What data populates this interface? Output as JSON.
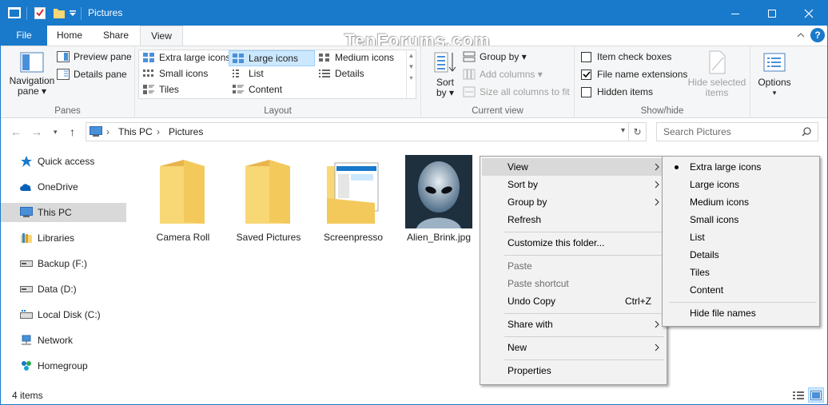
{
  "window": {
    "title": "Pictures"
  },
  "tabs": {
    "file": "File",
    "home": "Home",
    "share": "Share",
    "view": "View"
  },
  "watermark": "TenForums.com",
  "ribbon": {
    "panes": {
      "navigation_pane": "Navigation",
      "navigation_pane_sub": "pane",
      "preview_pane": "Preview pane",
      "details_pane": "Details pane",
      "label": "Panes"
    },
    "layout": {
      "label": "Layout",
      "options": [
        "Extra large icons",
        "Large icons",
        "Medium icons",
        "Small icons",
        "List",
        "Details",
        "Tiles",
        "Content"
      ],
      "selected": "Large icons"
    },
    "current_view": {
      "sort_by": "Sort",
      "sort_by_sub": "by",
      "group_by": "Group by",
      "add_columns": "Add columns",
      "size_columns": "Size all columns to fit",
      "label": "Current view"
    },
    "show_hide": {
      "item_check_boxes": "Item check boxes",
      "file_name_extensions": "File name extensions",
      "hidden_items": "Hidden items",
      "hide_selected": "Hide selected",
      "hide_selected_sub": "items",
      "label": "Show/hide"
    },
    "options": {
      "label": "Options"
    }
  },
  "address": {
    "crumbs": [
      "This PC",
      "Pictures"
    ],
    "search_placeholder": "Search Pictures"
  },
  "sidebar": {
    "items": [
      "Quick access",
      "OneDrive",
      "This PC",
      "Libraries",
      "Backup (F:)",
      "Data (D:)",
      "Local Disk (C:)",
      "Network",
      "Homegroup"
    ],
    "selected": "This PC"
  },
  "files": [
    {
      "name": "Camera Roll"
    },
    {
      "name": "Saved Pictures"
    },
    {
      "name": "Screenpresso"
    },
    {
      "name": "Alien_Brink.jpg"
    }
  ],
  "status": {
    "count": "4 items"
  },
  "context_menu": {
    "view": "View",
    "sort_by": "Sort by",
    "group_by": "Group by",
    "refresh": "Refresh",
    "customize": "Customize this folder...",
    "paste": "Paste",
    "paste_shortcut": "Paste shortcut",
    "undo_copy": "Undo Copy",
    "undo_shortcut": "Ctrl+Z",
    "share_with": "Share with",
    "new": "New",
    "properties": "Properties"
  },
  "view_submenu": {
    "items": [
      "Extra large icons",
      "Large icons",
      "Medium icons",
      "Small icons",
      "List",
      "Details",
      "Tiles",
      "Content"
    ],
    "selected": "Large icons",
    "hide_file_names": "Hide file names"
  },
  "colors": {
    "accent": "#1979ca",
    "selection": "#cce8ff",
    "folder": "#f8d775"
  }
}
